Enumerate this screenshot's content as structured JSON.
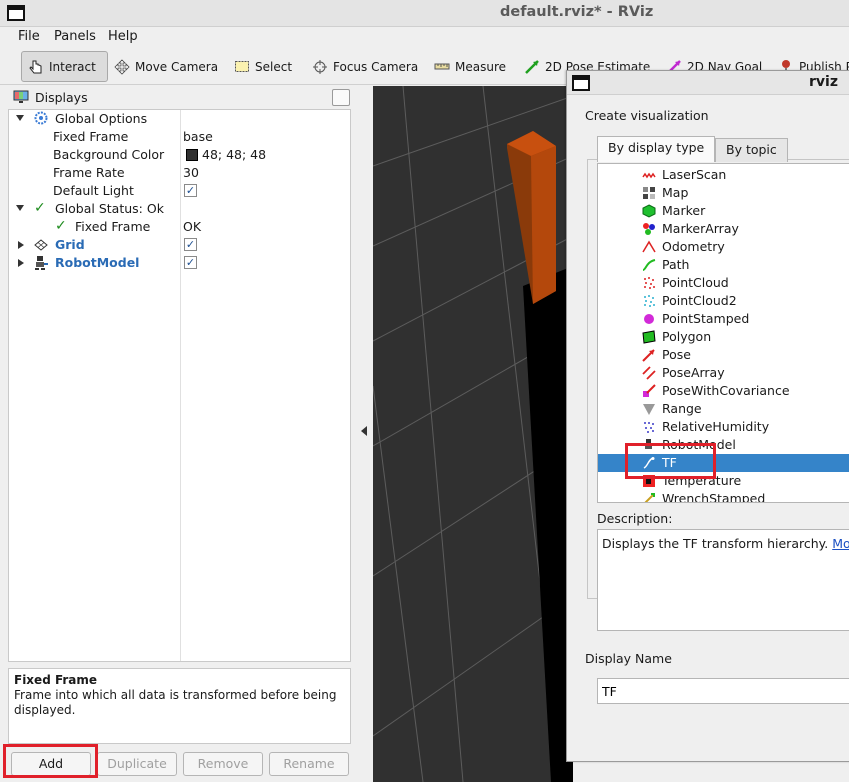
{
  "window": {
    "title": "default.rviz* - RViz"
  },
  "menu": [
    "File",
    "Panels",
    "Help"
  ],
  "toolbar": {
    "tools": [
      {
        "label": "Interact",
        "icon": "hand-pointer-icon"
      },
      {
        "label": "Move Camera",
        "icon": "move-camera-icon"
      },
      {
        "label": "Select",
        "icon": "select-box-icon"
      },
      {
        "label": "Focus Camera",
        "icon": "focus-camera-icon"
      },
      {
        "label": "Measure",
        "icon": "ruler-icon"
      },
      {
        "label": "2D Pose Estimate",
        "icon": "green-arrow-icon"
      },
      {
        "label": "2D Nav Goal",
        "icon": "pink-arrow-icon"
      },
      {
        "label": "Publish Point",
        "icon": "pin-icon"
      }
    ]
  },
  "displays": {
    "title": "Displays",
    "global_options": "Global Options",
    "fixed_frame_label": "Fixed Frame",
    "fixed_frame_value": "base",
    "bg_color_label": "Background Color",
    "bg_color_value": "48; 48; 48",
    "bg_color_swatch": "#303030",
    "frame_rate_label": "Frame Rate",
    "frame_rate_value": "30",
    "default_light_label": "Default Light",
    "global_status": "Global Status: Ok",
    "status_fixed_frame": "Fixed Frame",
    "status_fixed_frame_value": "OK",
    "grid": "Grid",
    "robot_model": "RobotModel"
  },
  "description": {
    "title": "Fixed Frame",
    "text": "Frame into which all data is transformed before being displayed."
  },
  "buttons": {
    "add": "Add",
    "duplicate": "Duplicate",
    "remove": "Remove",
    "rename": "Rename"
  },
  "dialog": {
    "title": "rviz",
    "heading": "Create visualization",
    "tab_display_type": "By display type",
    "tab_topic": "By topic",
    "types": [
      "LaserScan",
      "Map",
      "Marker",
      "MarkerArray",
      "Odometry",
      "Path",
      "PointCloud",
      "PointCloud2",
      "PointStamped",
      "Polygon",
      "Pose",
      "PoseArray",
      "PoseWithCovariance",
      "Range",
      "RelativeHumidity",
      "RobotModel",
      "TF",
      "Temperature",
      "WrenchStamped"
    ],
    "selected": "TF",
    "description_label": "Description:",
    "description_text": "Displays the TF transform hierarchy.",
    "description_link": "More",
    "display_name_label": "Display Name",
    "display_name_value": "TF"
  }
}
